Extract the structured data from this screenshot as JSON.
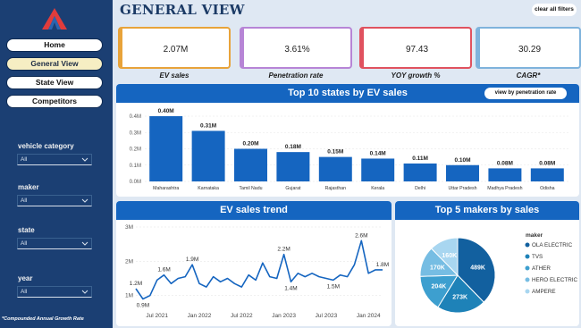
{
  "header": {
    "title": "GENERAL VIEW",
    "clear_filters": "clear all filters"
  },
  "nav": [
    "Home",
    "General View",
    "State View",
    "Competitors"
  ],
  "filters": [
    {
      "label": "vehicle category",
      "value": "All"
    },
    {
      "label": "maker",
      "value": "All"
    },
    {
      "label": "state",
      "value": "All"
    },
    {
      "label": "year",
      "value": "All"
    }
  ],
  "footnote": "*Compounded Annual Growth Rate",
  "kpis": [
    {
      "value": "2.07M",
      "label": "EV sales",
      "color": "#e8a33a"
    },
    {
      "value": "3.61%",
      "label": "Penetration rate",
      "color": "#b785d6"
    },
    {
      "value": "97.43",
      "label": "YOY growth %",
      "color": "#e0525f"
    },
    {
      "value": "30.29",
      "label": "CAGR*",
      "color": "#7fb3dc"
    }
  ],
  "colors": {
    "sidebar": "#1b3f73",
    "accent": "#1565c0",
    "bar": "#1565c0"
  },
  "chart_data": [
    {
      "type": "bar",
      "title": "Top 10 states by EV sales",
      "button": "view by penetration rate",
      "categories": [
        "Maharashtra",
        "Karnataka",
        "Tamil Nadu",
        "Gujarat",
        "Rajasthan",
        "Kerala",
        "Delhi",
        "Uttar Pradesh",
        "Madhya Pradesh",
        "Odisha"
      ],
      "values": [
        0.4,
        0.31,
        0.2,
        0.18,
        0.15,
        0.14,
        0.11,
        0.1,
        0.08,
        0.08
      ],
      "labels": [
        "0.40M",
        "0.31M",
        "0.20M",
        "0.18M",
        "0.15M",
        "0.14M",
        "0.11M",
        "0.10M",
        "0.08M",
        "0.08M"
      ],
      "yticks": [
        "0.0M",
        "0.1M",
        "0.2M",
        "0.3M",
        "0.4M"
      ],
      "ylim": [
        0,
        0.4
      ]
    },
    {
      "type": "line",
      "title": "EV sales trend",
      "x": [
        "2021-04",
        "2021-05",
        "2021-06",
        "2021-07",
        "2021-08",
        "2021-09",
        "2021-10",
        "2021-11",
        "2021-12",
        "2022-01",
        "2022-02",
        "2022-03",
        "2022-04",
        "2022-05",
        "2022-06",
        "2022-07",
        "2022-08",
        "2022-09",
        "2022-10",
        "2022-11",
        "2022-12",
        "2023-01",
        "2023-02",
        "2023-03",
        "2023-04",
        "2023-05",
        "2023-06",
        "2023-07",
        "2023-08",
        "2023-09",
        "2023-10",
        "2023-11",
        "2023-12",
        "2024-01",
        "2024-02",
        "2024-03"
      ],
      "values": [
        1.2,
        0.9,
        1.0,
        1.45,
        1.6,
        1.35,
        1.5,
        1.55,
        1.9,
        1.35,
        1.25,
        1.55,
        1.4,
        1.5,
        1.35,
        1.25,
        1.6,
        1.45,
        1.95,
        1.55,
        1.5,
        2.2,
        1.4,
        1.65,
        1.55,
        1.65,
        1.55,
        1.5,
        1.45,
        1.6,
        1.55,
        1.9,
        2.6,
        1.65,
        1.75,
        1.75
      ],
      "point_labels": {
        "0": "1.2M",
        "1": "0.9M",
        "4": "1.6M",
        "8": "1.9M",
        "21": "2.2M",
        "22": "1.4M",
        "28": "1.5M",
        "32": "2.6M",
        "35": "1.8M"
      },
      "xticks": [
        {
          "label": "Jul 2021",
          "index": 3
        },
        {
          "label": "Jan 2022",
          "index": 9
        },
        {
          "label": "Jul 2022",
          "index": 15
        },
        {
          "label": "Jan 2023",
          "index": 21
        },
        {
          "label": "Jul 2023",
          "index": 27
        },
        {
          "label": "Jan 2024",
          "index": 33
        }
      ],
      "yticks": [
        "1M",
        "2M",
        "3M"
      ],
      "ylim": [
        0.6,
        3.0
      ]
    },
    {
      "type": "pie",
      "title": "Top 5 makers by sales",
      "legend_title": "maker",
      "categories": [
        "OLA ELECTRIC",
        "TVS",
        "ATHER",
        "HERO ELECTRIC",
        "AMPERE"
      ],
      "values": [
        489,
        273,
        204,
        170,
        160
      ],
      "labels": [
        "489K",
        "273K",
        "204K",
        "170K",
        "160K"
      ],
      "colors": [
        "#12609f",
        "#1e82b8",
        "#3d9fcf",
        "#76bde3",
        "#a8d6f0"
      ]
    }
  ]
}
